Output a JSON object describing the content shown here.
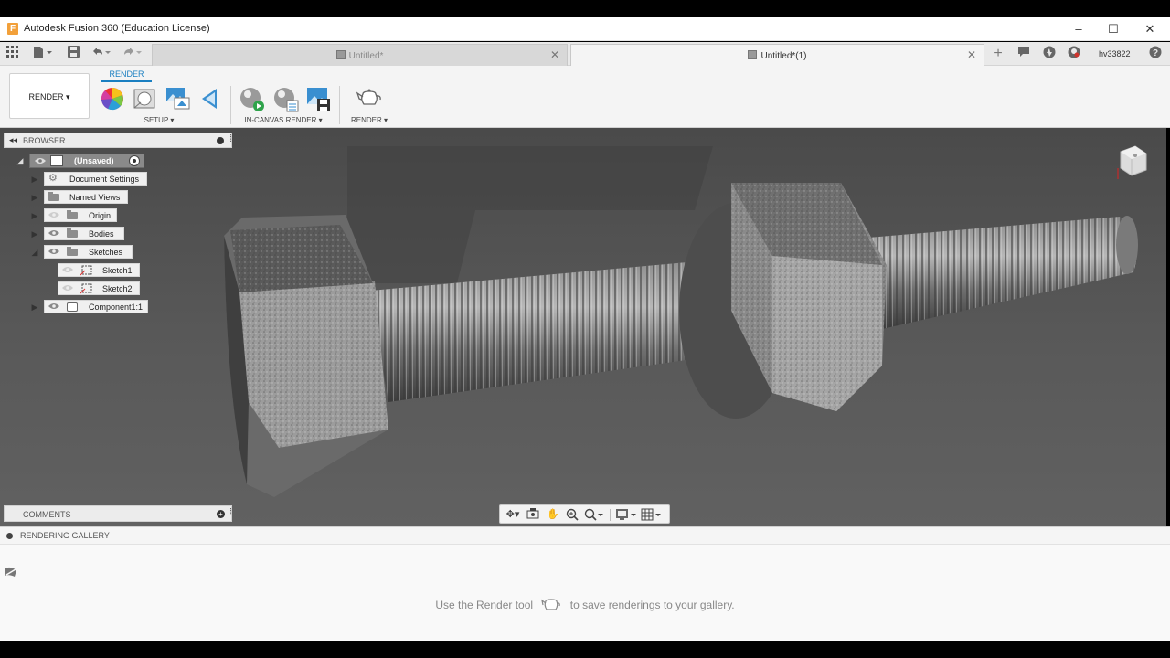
{
  "window": {
    "title": "Autodesk Fusion 360 (Education License)",
    "logo_letter": "F",
    "minimize_glyph": "–",
    "maximize_glyph": "☐",
    "close_glyph": "✕"
  },
  "tabs": [
    {
      "label": "Untitled*",
      "active": false
    },
    {
      "label": "Untitled*(1)",
      "active": true
    }
  ],
  "user": {
    "name": "hv33822"
  },
  "ribbon": {
    "workspace": "RENDER ▾",
    "active_tab": "RENDER",
    "groups": [
      {
        "label": "SETUP ▾"
      },
      {
        "label": "IN-CANVAS RENDER ▾"
      },
      {
        "label": "RENDER ▾"
      }
    ]
  },
  "browser": {
    "title": "BROWSER",
    "nodes": [
      {
        "label": "(Unsaved)"
      },
      {
        "label": "Document Settings"
      },
      {
        "label": "Named Views"
      },
      {
        "label": "Origin"
      },
      {
        "label": "Bodies"
      },
      {
        "label": "Sketches"
      },
      {
        "label": "Sketch1"
      },
      {
        "label": "Sketch2"
      },
      {
        "label": "Component1:1"
      }
    ]
  },
  "comments": {
    "title": "COMMENTS"
  },
  "gallery": {
    "title": "RENDERING GALLERY",
    "message_before": "Use the Render tool",
    "message_after": "to save renderings to your gallery."
  },
  "colors": {
    "accent": "#1a7fc1",
    "viewport": "#555555",
    "panel": "#f4f4f4"
  },
  "icons": [
    "grid-icon",
    "file-icon",
    "save-icon",
    "undo-icon",
    "redo-icon",
    "add-tab-icon",
    "chat-icon",
    "job-status-icon",
    "user-icon",
    "help-icon",
    "view-cube-icon",
    "orbit-icon",
    "look-at-icon",
    "pan-icon",
    "zoom-icon",
    "fit-icon",
    "display-settings-icon",
    "grid-settings-icon"
  ]
}
